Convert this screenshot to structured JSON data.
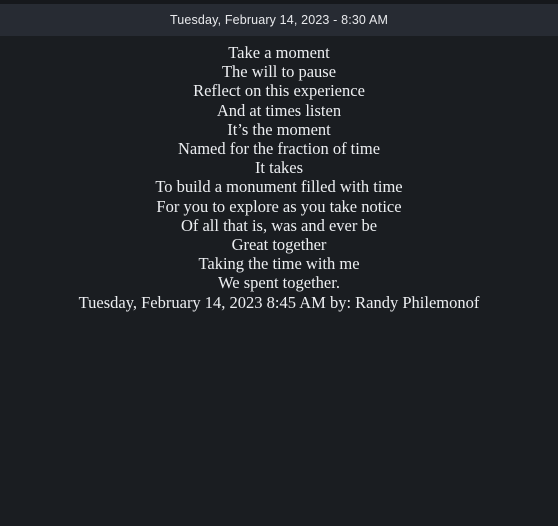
{
  "window": {
    "title": "Tuesday, February 14, 2023 - 8:30 AM"
  },
  "content": {
    "lines": [
      "Take a moment",
      "The will to pause",
      "Reflect on this experience",
      "And at times listen",
      "It’s the moment",
      "Named for the fraction of time",
      "It takes",
      "To build a monument filled with time",
      "For you to explore as you take notice",
      "Of all that is, was and ever be",
      "Great together",
      "Taking the time with me",
      "We spent together.",
      "Tuesday, February 14, 2023 8:45 AM by: Randy Philemonof"
    ]
  },
  "colors": {
    "window_background": "#1a1d21",
    "title_bar_background": "#272b33",
    "title_bar_text": "#e8e9ec",
    "body_text": "#eceef1",
    "top_edge": "#16181c"
  }
}
